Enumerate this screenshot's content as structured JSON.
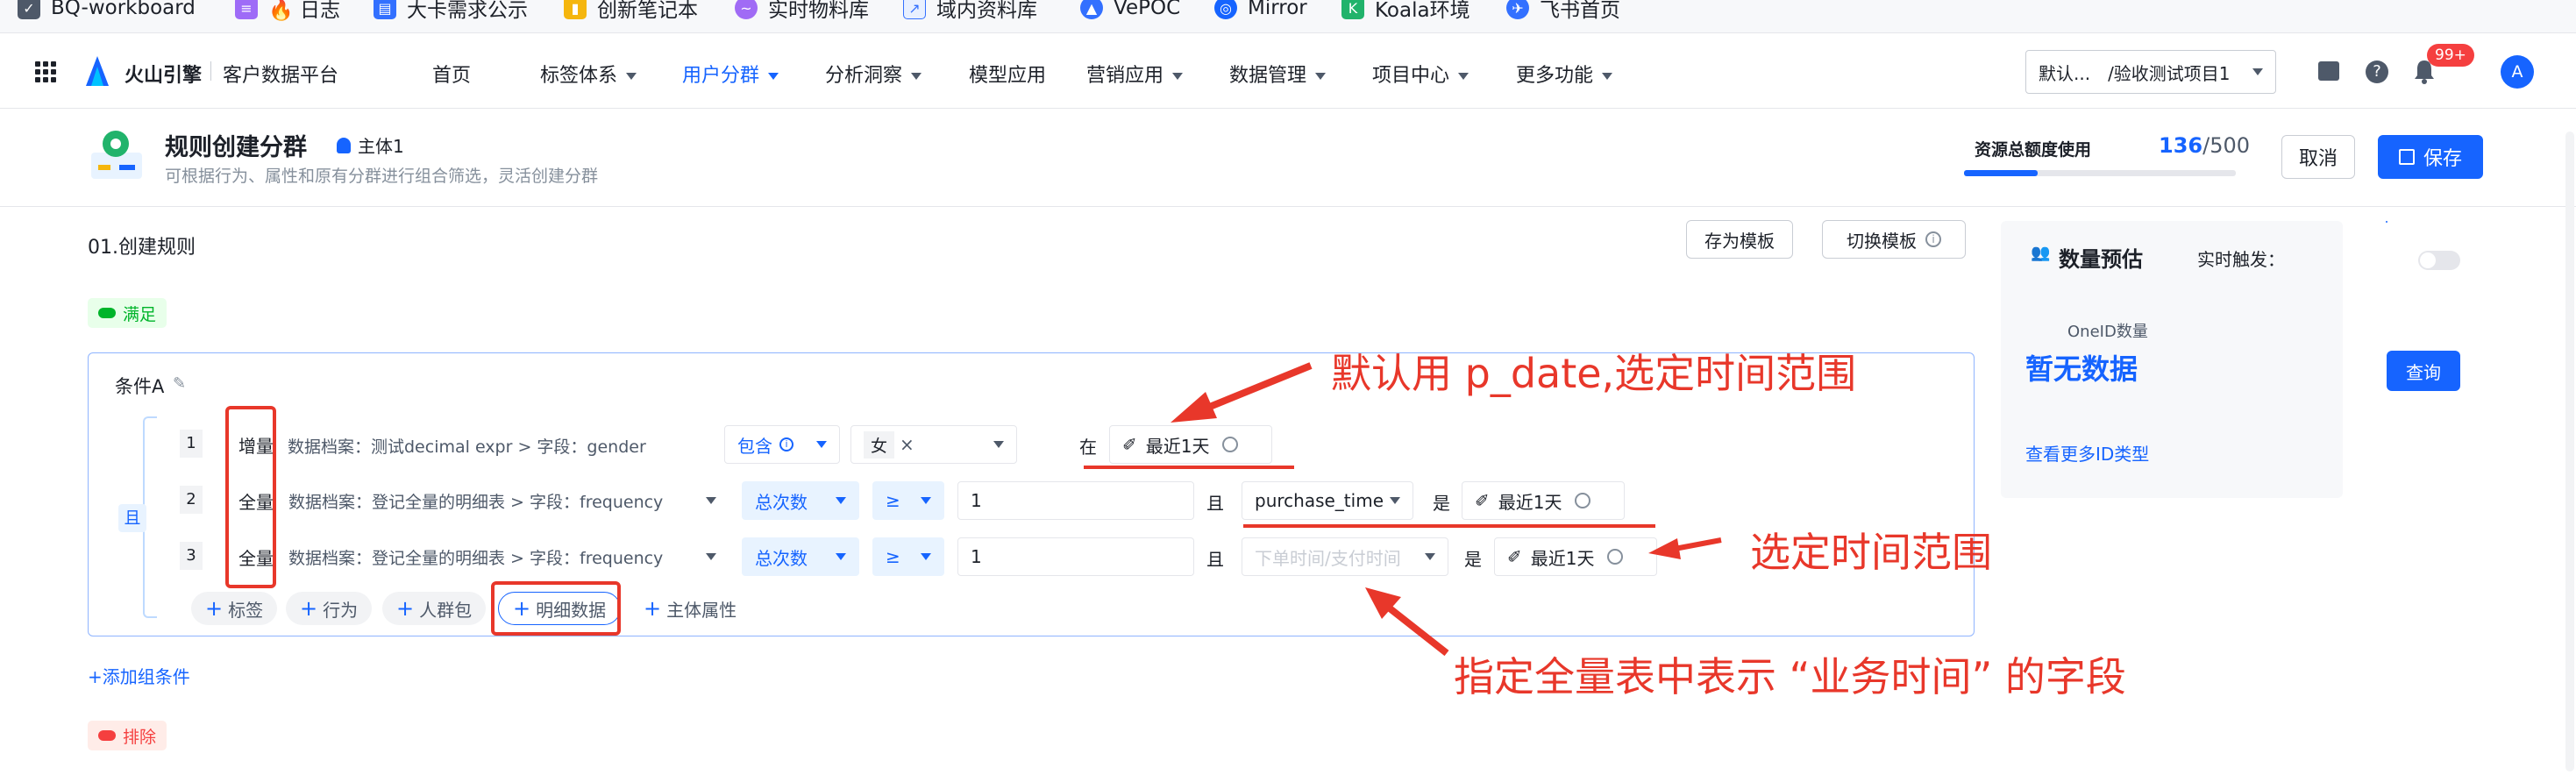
{
  "bookmarks": [
    {
      "label": "BQ-workboard",
      "icon": "checkbox-icon",
      "color": "#4e5969"
    },
    {
      "label": "🔥 日志",
      "icon": "list-icon",
      "color": "#9e6bf7"
    },
    {
      "label": "大卡需求公示",
      "icon": "doc-icon",
      "color": "#3370ff"
    },
    {
      "label": "创新笔记本",
      "icon": "folder-icon",
      "color": "#f5b60e"
    },
    {
      "label": "实时物料库",
      "icon": "wave-icon",
      "color": "#a06bf5"
    },
    {
      "label": "域内资料库",
      "icon": "chart-icon",
      "color": "#3370ff"
    },
    {
      "label": "VePOC",
      "icon": "bird-icon",
      "color": "#3370ff"
    },
    {
      "label": "Mirror",
      "icon": "mirror-icon",
      "color": "#1664ff"
    },
    {
      "label": "Koala环境",
      "icon": "koala-icon",
      "color": "#21b36b"
    },
    {
      "label": "飞书首页",
      "icon": "lark-icon",
      "color": "#3370ff"
    }
  ],
  "nav": {
    "brand": "火山引擎",
    "platform": "客户数据平台",
    "menu": [
      "首页",
      "标签体系",
      "用户分群",
      "分析洞察",
      "模型应用",
      "营销应用",
      "数据管理",
      "项目中心",
      "更多功能"
    ],
    "active": "用户分群",
    "project_select": "默认...　/验收测试项目1",
    "badge": "99+",
    "avatar": "A"
  },
  "header": {
    "title": "规则创建分群",
    "subject": "主体1",
    "subtitle": "可根据行为、属性和原有分群进行组合筛选，灵活创建分群",
    "quota_label": "资源总额度使用",
    "quota_used": "136",
    "quota_total": "/500",
    "quota_fraction": 0.27,
    "cancel": "取消",
    "save": "保存"
  },
  "rules": {
    "section_title": "01.创建规则",
    "save_template": "存为模板",
    "switch_template": "切换模板",
    "satisfy": "满足",
    "exclude": "排除",
    "condition_title": "条件A",
    "and": "且",
    "rows": [
      {
        "idx": "1",
        "type": "增量",
        "path": "数据档案：测试decimal expr > 字段：gender",
        "op": "包含",
        "value": "女",
        "conj": "在",
        "time": "最近1天"
      },
      {
        "idx": "2",
        "type": "全量",
        "path": "数据档案：登记全量的明细表 > 字段：frequency",
        "agg": "总次数",
        "cmp": "≥",
        "num": "1",
        "conj": "且",
        "field": "purchase_time",
        "is": "是",
        "time": "最近1天"
      },
      {
        "idx": "3",
        "type": "全量",
        "path": "数据档案：登记全量的明细表 > 字段：frequency",
        "agg": "总次数",
        "cmp": "≥",
        "num": "1",
        "conj": "且",
        "field_placeholder": "下单时间/支付时间",
        "is": "是",
        "time": "最近1天"
      }
    ],
    "add_buttons": [
      "标签",
      "行为",
      "人群包",
      "明细数据",
      "主体属性"
    ],
    "add_group": "+添加组条件"
  },
  "preview": {
    "title": "数量预估",
    "realtime": "实时触发：",
    "oneid_label": "OneID数量",
    "no_data": "暂无数据",
    "query": "查询",
    "more": "查看更多ID类型"
  },
  "annotations": {
    "a1": "默认用 p_date,选定时间范围",
    "a2": "选定时间范围",
    "a3": "指定全量表中表示 “业务时间” 的字段",
    "color": "#e8372a"
  }
}
